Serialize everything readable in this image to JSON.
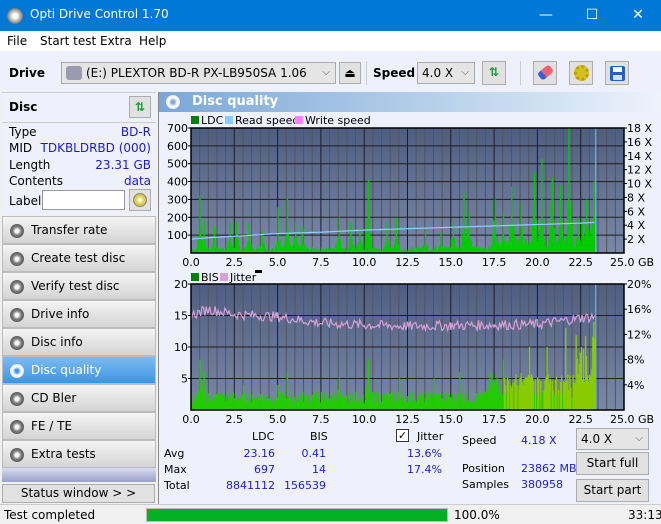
{
  "window": {
    "title": "Opti Drive Control 1.70",
    "minimize": "—",
    "maximize": "☐",
    "close": "✕"
  },
  "menu": [
    "File",
    "Start test",
    "Extra",
    "Help"
  ],
  "toolbar": {
    "drive_label": "Drive",
    "drive_value": "(E:)  PLEXTOR BD-R  PX-LB950SA 1.06",
    "speed_label": "Speed",
    "speed_value": "4.0 X"
  },
  "disc": {
    "header": "Disc",
    "rows": [
      {
        "label": "Type",
        "value": "BD-R"
      },
      {
        "label": "MID",
        "value": "TDKBLDRBD (000)"
      },
      {
        "label": "Length",
        "value": "23.31 GB"
      },
      {
        "label": "Contents",
        "value": "data"
      }
    ],
    "label_field_label": "Label",
    "label_field_value": ""
  },
  "nav": [
    {
      "label": "Transfer rate",
      "active": false
    },
    {
      "label": "Create test disc",
      "active": false
    },
    {
      "label": "Verify test disc",
      "active": false
    },
    {
      "label": "Drive info",
      "active": false
    },
    {
      "label": "Disc info",
      "active": false
    },
    {
      "label": "Disc quality",
      "active": true
    },
    {
      "label": "CD Bler",
      "active": false
    },
    {
      "label": "FE / TE",
      "active": false
    },
    {
      "label": "Extra tests",
      "active": false
    }
  ],
  "status_window_button": "Status window > >",
  "panel_title": "Disc quality",
  "chart_data": [
    {
      "type": "bar",
      "title": "LDC / Read speed",
      "legend": [
        "LDC",
        "Read speed",
        "Write speed"
      ],
      "legend_colors": [
        "#008000",
        "#87cefa",
        "#ff80ff"
      ],
      "legend_placement": "top-left",
      "xlabel": "GB",
      "xlim": [
        0,
        25
      ],
      "x_ticks": [
        "0.0",
        "2.5",
        "5.0",
        "7.5",
        "10.0",
        "12.5",
        "15.0",
        "17.5",
        "20.0",
        "22.5",
        "25.0 GB"
      ],
      "ylim_left": [
        0,
        700
      ],
      "y_ticks_left": [
        "700",
        "600",
        "500",
        "400",
        "300",
        "200",
        "100"
      ],
      "ylim_right": [
        0,
        18
      ],
      "y_ticks_right": [
        "18 X",
        "16 X",
        "14 X",
        "12 X",
        "10 X",
        "8 X",
        "6 X",
        "4 X",
        "2 X"
      ],
      "ldc_peaks": [
        [
          0.5,
          320
        ],
        [
          0.7,
          180
        ],
        [
          1.3,
          150
        ],
        [
          2.2,
          170
        ],
        [
          2.6,
          175
        ],
        [
          3.3,
          170
        ],
        [
          4.1,
          120
        ],
        [
          5.0,
          255
        ],
        [
          5.5,
          310
        ],
        [
          6.0,
          170
        ],
        [
          6.4,
          150
        ],
        [
          8.5,
          200
        ],
        [
          9.2,
          175
        ],
        [
          9.7,
          140
        ],
        [
          10.2,
          410
        ],
        [
          11.3,
          175
        ],
        [
          11.8,
          195
        ],
        [
          13.5,
          135
        ],
        [
          14.4,
          120
        ],
        [
          15.1,
          175
        ],
        [
          15.7,
          340
        ],
        [
          16.0,
          240
        ],
        [
          17.5,
          300
        ],
        [
          18.0,
          230
        ],
        [
          18.5,
          370
        ],
        [
          19.0,
          280
        ],
        [
          19.8,
          450
        ],
        [
          20.2,
          530
        ],
        [
          20.8,
          420
        ],
        [
          21.3,
          380
        ],
        [
          21.8,
          697
        ],
        [
          22.3,
          200
        ],
        [
          22.8,
          300
        ],
        [
          23.2,
          400
        ],
        [
          23.31,
          430
        ]
      ],
      "read_speed": [
        [
          0,
          2.0
        ],
        [
          1.0,
          2.2
        ],
        [
          2.5,
          2.4
        ],
        [
          5.0,
          2.8
        ],
        [
          7.5,
          3.0
        ],
        [
          10.0,
          3.3
        ],
        [
          12.5,
          3.5
        ],
        [
          15.0,
          3.7
        ],
        [
          17.5,
          3.9
        ],
        [
          20.0,
          4.1
        ],
        [
          22.5,
          4.3
        ],
        [
          23.31,
          4.4
        ]
      ],
      "end_marker_x": 23.31
    },
    {
      "type": "bar",
      "title": "BIS / Jitter",
      "legend": [
        "BIS",
        "Jitter"
      ],
      "legend_colors": [
        "#008000",
        "#d8a0d8"
      ],
      "legend_placement": "top-left",
      "xlabel": "GB",
      "xlim": [
        0,
        25
      ],
      "x_ticks": [
        "0.0",
        "2.5",
        "5.0",
        "7.5",
        "10.0",
        "12.5",
        "15.0",
        "17.5",
        "20.0",
        "22.5",
        "25.0 GB"
      ],
      "ylim_left": [
        0,
        20
      ],
      "y_ticks_left": [
        "20",
        "15",
        "10",
        "5"
      ],
      "ylim_right": [
        0,
        20
      ],
      "y_ticks_right": [
        "20%",
        "16%",
        "12%",
        "8%",
        "4%"
      ],
      "bis_peaks": [
        [
          0.5,
          8
        ],
        [
          0.7,
          6
        ],
        [
          3.0,
          4
        ],
        [
          5.0,
          4
        ],
        [
          5.5,
          6
        ],
        [
          8.5,
          5
        ],
        [
          10.2,
          8
        ],
        [
          12.0,
          5
        ],
        [
          14.0,
          5
        ],
        [
          15.5,
          6
        ],
        [
          18.0,
          8
        ],
        [
          19.5,
          10
        ],
        [
          20.5,
          10
        ],
        [
          21.6,
          13
        ],
        [
          22.5,
          10
        ],
        [
          23.2,
          14
        ]
      ],
      "jitter": [
        [
          0,
          15.0
        ],
        [
          1.0,
          16.0
        ],
        [
          2.5,
          15.2
        ],
        [
          5.0,
          14.8
        ],
        [
          7.5,
          13.8
        ],
        [
          10.0,
          13.5
        ],
        [
          12.5,
          13.3
        ],
        [
          15.0,
          13.4
        ],
        [
          17.5,
          13.5
        ],
        [
          20.0,
          13.6
        ],
        [
          22.5,
          14.6
        ],
        [
          23.31,
          14.8
        ]
      ],
      "end_marker_x": 23.31
    }
  ],
  "stats": {
    "headers": [
      "LDC",
      "BIS"
    ],
    "rows": [
      {
        "label": "Avg",
        "ldc": "23.16",
        "bis": "0.41",
        "jitter": "13.6%"
      },
      {
        "label": "Max",
        "ldc": "697",
        "bis": "14",
        "jitter": "17.4%"
      },
      {
        "label": "Total",
        "ldc": "8841112",
        "bis": "156539",
        "jitter": ""
      }
    ],
    "jitter_label": "Jitter",
    "jitter_checked": true,
    "speed_label": "Speed",
    "speed_value": "4.18 X",
    "position_label": "Position",
    "position_value": "23862 MB",
    "samples_label": "Samples",
    "samples_value": "380958",
    "speed_select": "4.0 X",
    "start_full": "Start full",
    "start_part": "Start part"
  },
  "statusbar": {
    "text": "Test completed",
    "progress": 100,
    "progress_text": "100.0%",
    "time": "33:13"
  }
}
